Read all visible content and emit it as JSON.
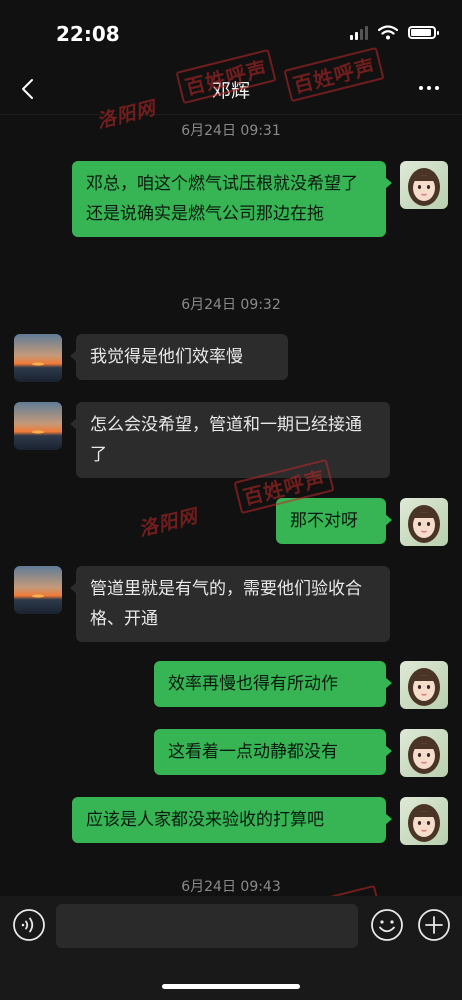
{
  "status_bar": {
    "time": "22:08"
  },
  "header": {
    "title": "邓辉"
  },
  "messages": [
    {
      "type": "time",
      "text": "6月24日 09:31"
    },
    {
      "type": "sent",
      "text": "邓总，咱这个燃气试压根就没希望了还是说确实是燃气公司那边在拖"
    },
    {
      "type": "time",
      "text": "6月24日 09:32"
    },
    {
      "type": "received",
      "text": "我觉得是他们效率慢"
    },
    {
      "type": "received",
      "text": "怎么会没希望，管道和一期已经接通了"
    },
    {
      "type": "sent",
      "text": "那不对呀"
    },
    {
      "type": "received",
      "text": "管道里就是有气的，需要他们验收合格、开通"
    },
    {
      "type": "sent",
      "text": "效率再慢也得有所动作"
    },
    {
      "type": "sent",
      "text": "这看着一点动静都没有"
    },
    {
      "type": "sent",
      "text": "应该是人家都没来验收的打算吧"
    },
    {
      "type": "time",
      "text": "6月24日 09:43"
    }
  ],
  "watermark": {
    "logo_text": "百姓呼声",
    "script_text": "洛阳网"
  },
  "colors": {
    "sent_bubble": "#37b454",
    "received_bubble": "#2c2c2c",
    "background": "#111111"
  },
  "icons": {
    "back": "chevron-left-icon",
    "more": "more-dots-icon",
    "voice": "voice-icon",
    "emoji": "emoji-icon",
    "add": "plus-icon"
  }
}
